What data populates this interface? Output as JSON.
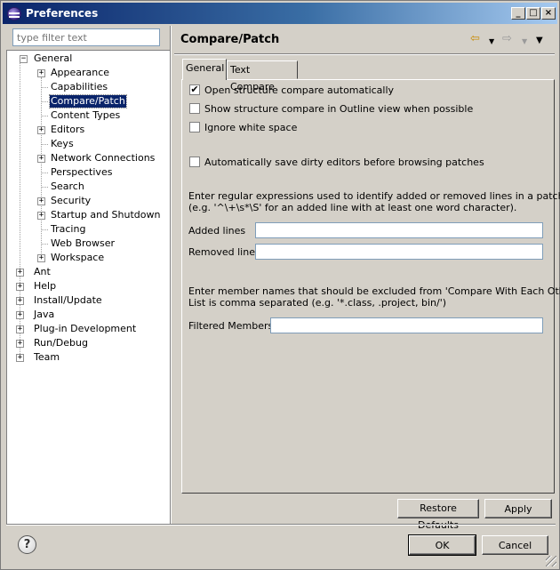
{
  "window": {
    "title": "Preferences"
  },
  "filter": {
    "placeholder": "type filter text"
  },
  "tree": [
    {
      "label": "General",
      "indent": 0,
      "expander": "minus"
    },
    {
      "label": "Appearance",
      "indent": 1,
      "expander": "plus"
    },
    {
      "label": "Capabilities",
      "indent": 1,
      "expander": "none"
    },
    {
      "label": "Compare/Patch",
      "indent": 1,
      "expander": "none",
      "selected": true
    },
    {
      "label": "Content Types",
      "indent": 1,
      "expander": "none"
    },
    {
      "label": "Editors",
      "indent": 1,
      "expander": "plus"
    },
    {
      "label": "Keys",
      "indent": 1,
      "expander": "none"
    },
    {
      "label": "Network Connections",
      "indent": 1,
      "expander": "plus"
    },
    {
      "label": "Perspectives",
      "indent": 1,
      "expander": "none"
    },
    {
      "label": "Search",
      "indent": 1,
      "expander": "none"
    },
    {
      "label": "Security",
      "indent": 1,
      "expander": "plus"
    },
    {
      "label": "Startup and Shutdown",
      "indent": 1,
      "expander": "plus"
    },
    {
      "label": "Tracing",
      "indent": 1,
      "expander": "none"
    },
    {
      "label": "Web Browser",
      "indent": 1,
      "expander": "none"
    },
    {
      "label": "Workspace",
      "indent": 1,
      "expander": "plus"
    },
    {
      "label": "Ant",
      "indent": 0,
      "expander": "plus"
    },
    {
      "label": "Help",
      "indent": 0,
      "expander": "plus"
    },
    {
      "label": "Install/Update",
      "indent": 0,
      "expander": "plus"
    },
    {
      "label": "Java",
      "indent": 0,
      "expander": "plus"
    },
    {
      "label": "Plug-in Development",
      "indent": 0,
      "expander": "plus"
    },
    {
      "label": "Run/Debug",
      "indent": 0,
      "expander": "plus"
    },
    {
      "label": "Team",
      "indent": 0,
      "expander": "plus"
    }
  ],
  "page": {
    "title": "Compare/Patch"
  },
  "tabs": [
    "General",
    "Text Compare"
  ],
  "options": {
    "open_structure": {
      "label": "Open structure compare automatically",
      "checked": true
    },
    "show_outline": {
      "label": "Show structure compare in Outline view when possible",
      "checked": false
    },
    "ignore_ws": {
      "label": "Ignore white space",
      "checked": false
    },
    "autosave": {
      "label": "Automatically save dirty editors before browsing patches",
      "checked": false
    }
  },
  "regex": {
    "desc1": "Enter regular expressions used to identify added or removed lines in a patch",
    "desc2": "(e.g. '^\\+\\s*\\S' for an added line with at least one word character).",
    "added_label": "Added lines",
    "added_value": "",
    "removed_label": "Removed lines",
    "removed_value": ""
  },
  "members": {
    "desc1": "Enter member names that should be excluded from 'Compare With Each Other'.",
    "desc2": "List is comma separated (e.g. '*.class, .project, bin/')",
    "filtered_label": "Filtered Members:",
    "filtered_value": ""
  },
  "buttons": {
    "restore": "Restore Defaults",
    "apply": "Apply",
    "ok": "OK",
    "cancel": "Cancel"
  },
  "icons": {
    "back": "back-arrow-icon",
    "forward": "forward-arrow-icon",
    "menu": "view-menu-icon",
    "help": "help-icon",
    "app": "eclipse-icon"
  }
}
